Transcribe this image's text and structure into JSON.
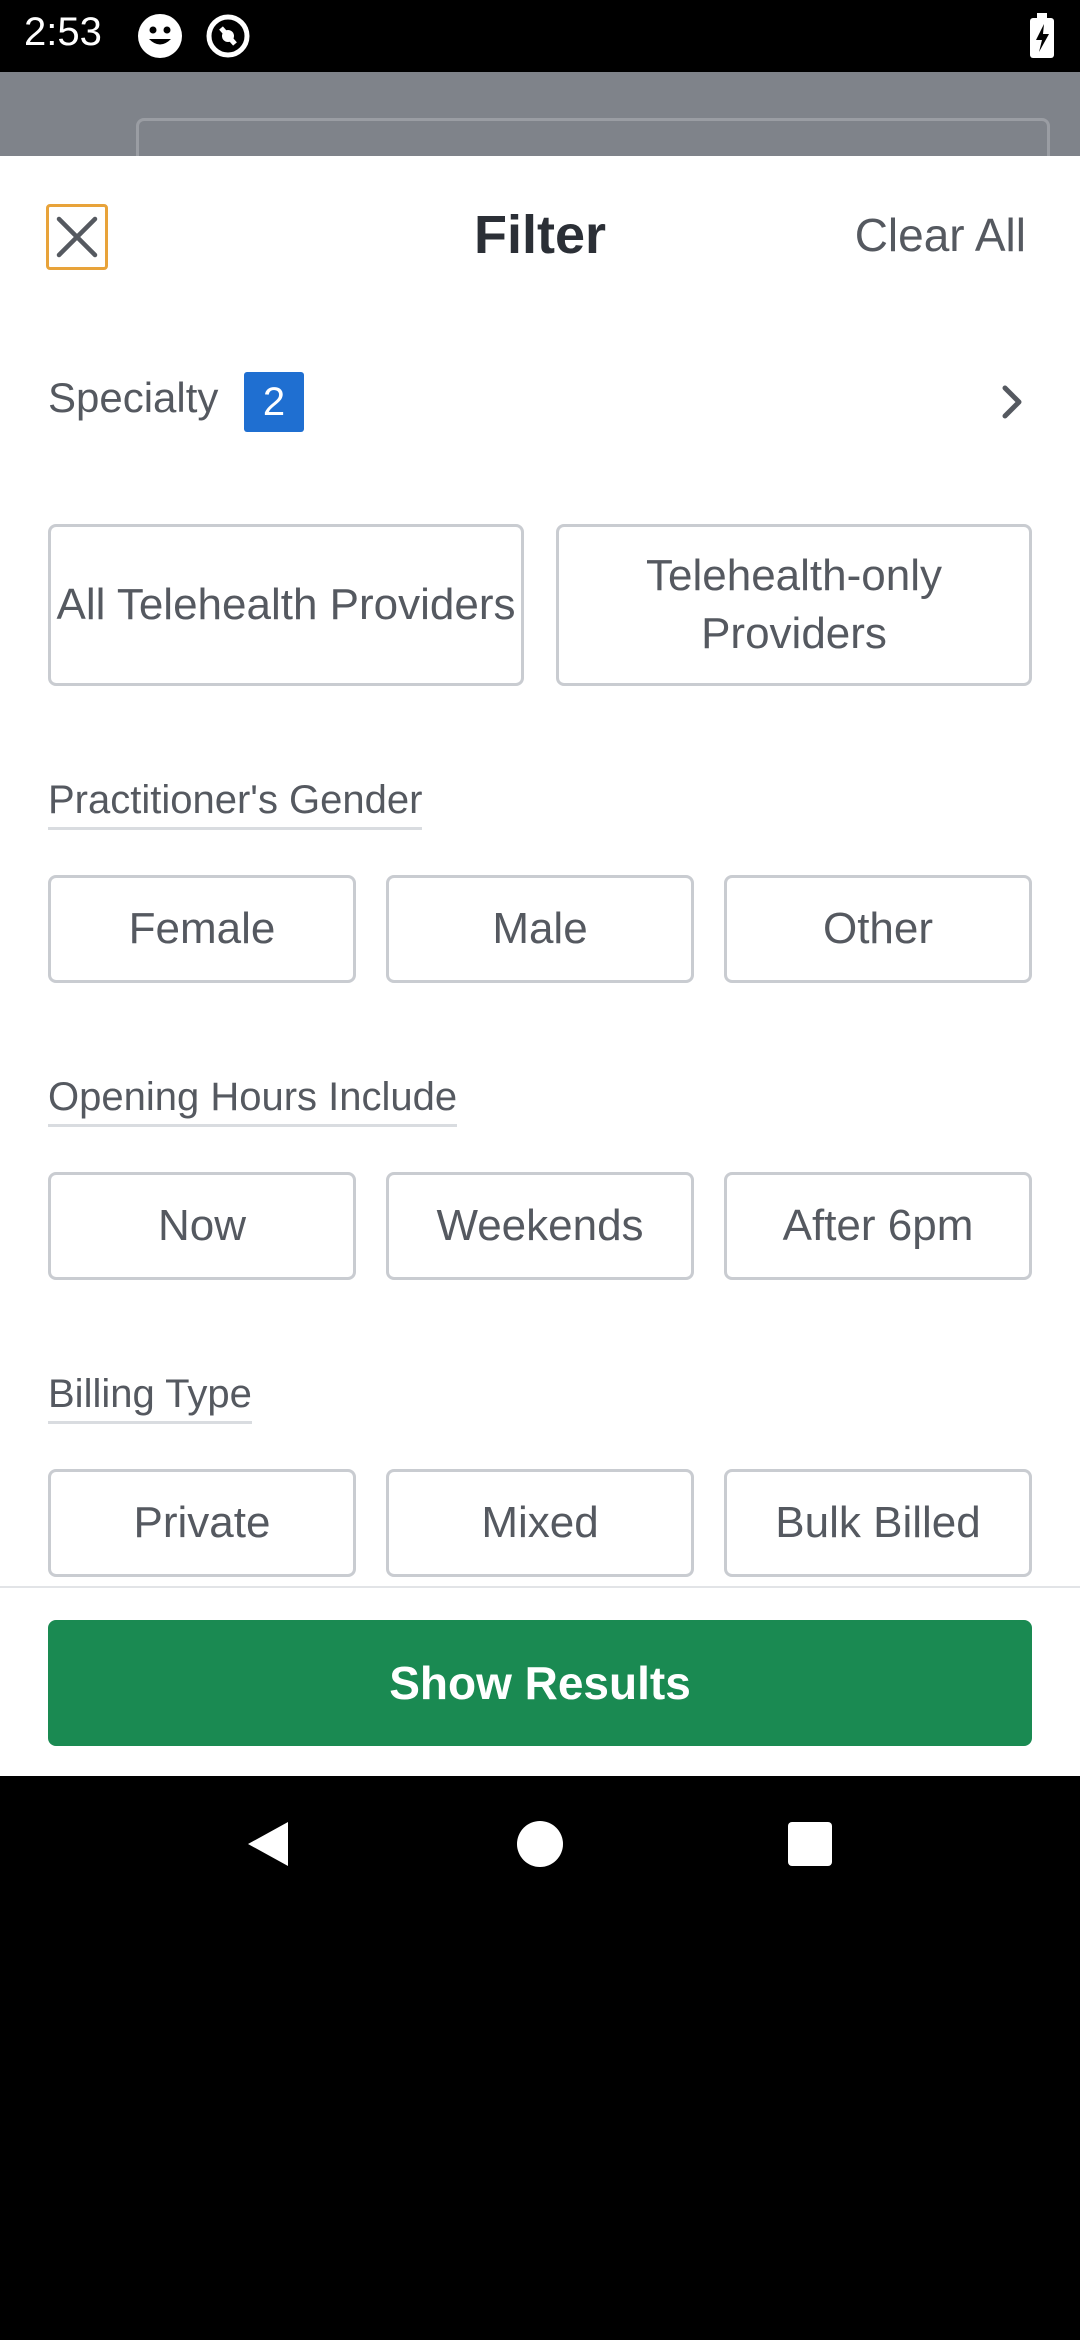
{
  "status": {
    "time": "2:53"
  },
  "header": {
    "title": "Filter",
    "clear_label": "Clear All"
  },
  "specialty": {
    "label": "Specialty",
    "count": "2"
  },
  "telehealth": {
    "options": [
      "All Telehealth Providers",
      "Telehealth-only Providers"
    ]
  },
  "gender": {
    "label": "Practitioner's Gender",
    "options": [
      "Female",
      "Male",
      "Other"
    ]
  },
  "hours": {
    "label": "Opening Hours Include",
    "options": [
      "Now",
      "Weekends",
      "After 6pm"
    ]
  },
  "billing": {
    "label": "Billing Type",
    "options": [
      "Private",
      "Mixed",
      "Bulk Billed"
    ]
  },
  "footer": {
    "show_results_label": "Show Results"
  },
  "colors": {
    "accent_green": "#1a8a52",
    "badge_blue": "#1f6fd1",
    "focus_outline": "#e8a33a"
  }
}
